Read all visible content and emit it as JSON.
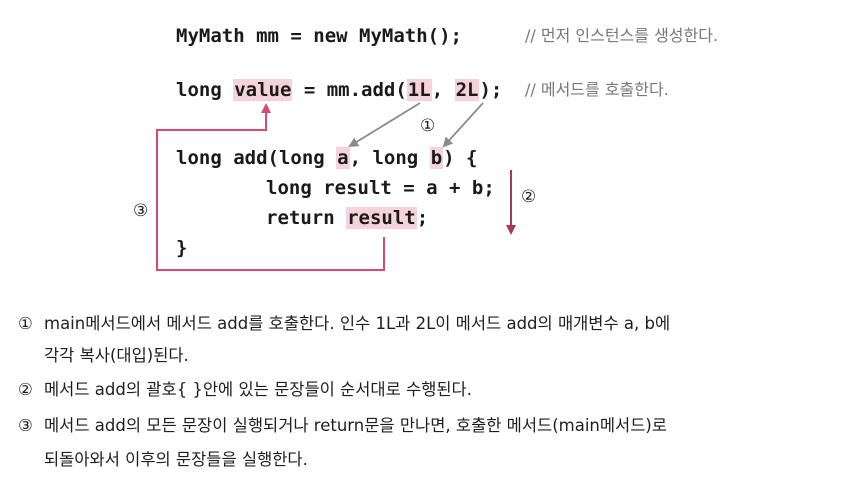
{
  "code": {
    "line1": {
      "text": "MyMath mm = new MyMath();",
      "comment": "// 먼저 인스턴스를 생성한다."
    },
    "line2": {
      "prefix": "long ",
      "value": "value",
      "mid": " = mm.add(",
      "arg1": "1L",
      "sep": ", ",
      "arg2": "2L",
      "suffix": ");",
      "comment": "// 메서드를 호출한다."
    },
    "line3": {
      "prefix": "long add(long ",
      "param_a": "a",
      "mid": ", long ",
      "param_b": "b",
      "suffix": ") {"
    },
    "line4": {
      "text": "long result = a + b;"
    },
    "line5": {
      "prefix": "return ",
      "result": "result",
      "suffix": ";"
    },
    "line6": {
      "text": "}"
    }
  },
  "markers": {
    "m1": "①",
    "m2": "②",
    "m3": "③"
  },
  "descriptions": {
    "d1_num": "①",
    "d1_line1": "main메서드에서 메서드 add를 호출한다. 인수 1L과 2L이 메서드 add의 매개변수 a, b에",
    "d1_line2": "각각 복사(대입)된다.",
    "d2_num": "②",
    "d2_line1": "메서드 add의 괄호{ }안에 있는 문장들이 순서대로 수행된다.",
    "d3_num": "③",
    "d3_line1": "메서드 add의 모든 문장이 실행되거나 return문을 만나면, 호출한 메서드(main메서드)로",
    "d3_line2": "되돌아와서 이후의 문장들을 실행한다."
  },
  "colors": {
    "highlight": "#f6d3dc",
    "return_arrow": "#d94a72",
    "step_arrow": "#b0384e",
    "param_arrow": "#8a8a8a"
  }
}
